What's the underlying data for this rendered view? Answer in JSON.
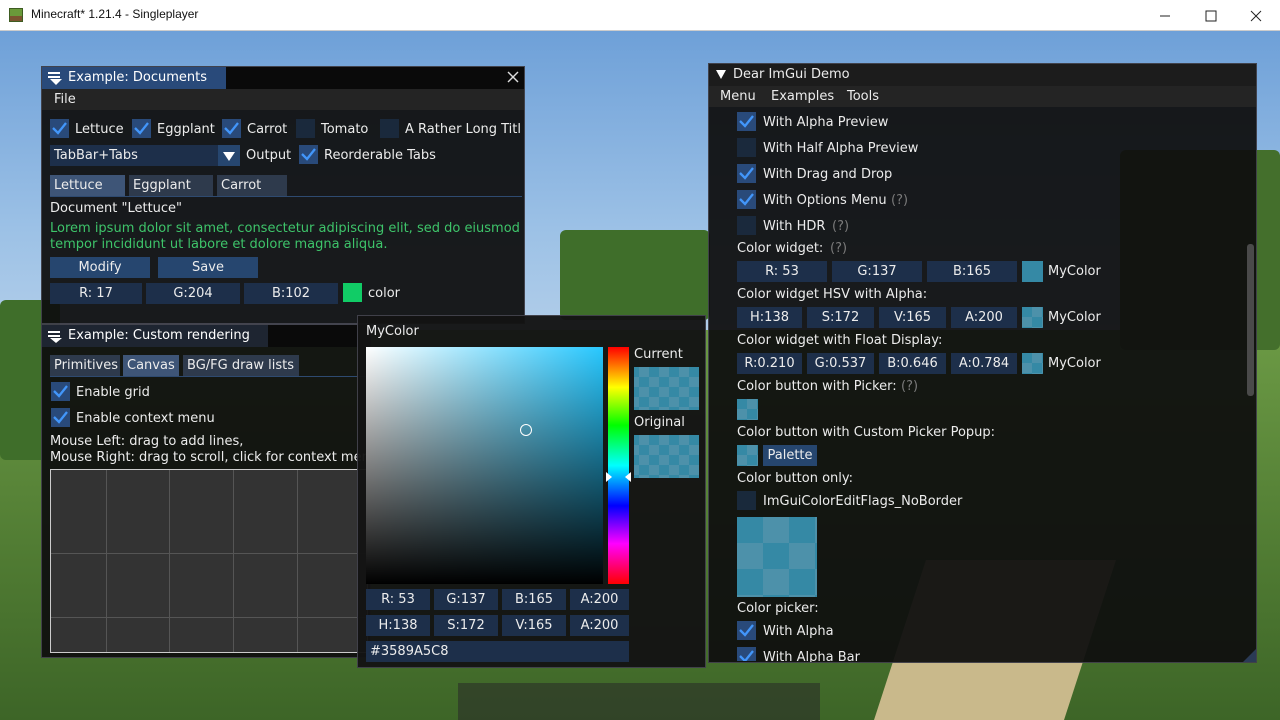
{
  "window": {
    "title": "Minecraft* 1.21.4 - Singleplayer"
  },
  "documents": {
    "title": "Example: Documents",
    "menu": [
      "File"
    ],
    "checks": [
      {
        "label": "Lettuce",
        "on": true
      },
      {
        "label": "Eggplant",
        "on": true
      },
      {
        "label": "Carrot",
        "on": true
      },
      {
        "label": "Tomato",
        "on": false
      },
      {
        "label": "A Rather Long Title",
        "on": false
      }
    ],
    "combo": "TabBar+Tabs",
    "output_label": "Output",
    "reorderable_label": "Reorderable Tabs",
    "tabs": [
      "Lettuce",
      "Eggplant",
      "Carrot"
    ],
    "doc_title": "Document \"Lettuce\"",
    "lorem1": "Lorem ipsum dolor sit amet, consectetur adipiscing elit, sed do eiusmod",
    "lorem2": "tempor incididunt ut labore et dolore magna aliqua.",
    "modify": "Modify",
    "save": "Save",
    "rgb": [
      "R: 17",
      "G:204",
      "B:102"
    ],
    "color_label": "color",
    "swatch_color": "#11cc66"
  },
  "custom": {
    "title": "Example: Custom rendering",
    "tabs": [
      "Primitives",
      "Canvas",
      "BG/FG draw lists"
    ],
    "enable_grid": "Enable grid",
    "enable_menu": "Enable context menu",
    "help1": "Mouse Left: drag to add lines,",
    "help2": "Mouse Right: drag to scroll, click for context menu."
  },
  "picker": {
    "title": "MyColor",
    "current": "Current",
    "original": "Original",
    "rgba": [
      "R: 53",
      "G:137",
      "B:165",
      "A:200"
    ],
    "hsva": [
      "H:138",
      "S:172",
      "V:165",
      "A:200"
    ],
    "hex": "#3589A5C8",
    "color": "#3589a5"
  },
  "demo": {
    "title": "Dear ImGui Demo",
    "menu": [
      "Menu",
      "Examples",
      "Tools"
    ],
    "opts": [
      {
        "label": "With Alpha Preview",
        "on": true
      },
      {
        "label": "With Half Alpha Preview",
        "on": false
      },
      {
        "label": "With Drag and Drop",
        "on": true
      },
      {
        "label": "With Options Menu",
        "on": true,
        "hint": "(?)"
      },
      {
        "label": "With HDR",
        "on": false,
        "hint": "(?)"
      }
    ],
    "cw_label": "Color widget:",
    "cw_hint": "(?)",
    "cw_vals": [
      "R: 53",
      "G:137",
      "B:165"
    ],
    "mycolor": "MyColor",
    "hsv_label": "Color widget HSV with Alpha:",
    "hsv_vals": [
      "H:138",
      "S:172",
      "V:165",
      "A:200"
    ],
    "float_label": "Color widget with Float Display:",
    "float_vals": [
      "R:0.210",
      "G:0.537",
      "B:0.646",
      "A:0.784"
    ],
    "cbp_label": "Color button with Picker:",
    "cbp_hint": "(?)",
    "custom_label": "Color button with Custom Picker Popup:",
    "palette": "Palette",
    "only_label": "Color button only:",
    "noborder": "ImGuiColorEditFlags_NoBorder",
    "picker_label": "Color picker:",
    "with_alpha": "With Alpha",
    "with_alpha_bar": "With Alpha Bar"
  }
}
